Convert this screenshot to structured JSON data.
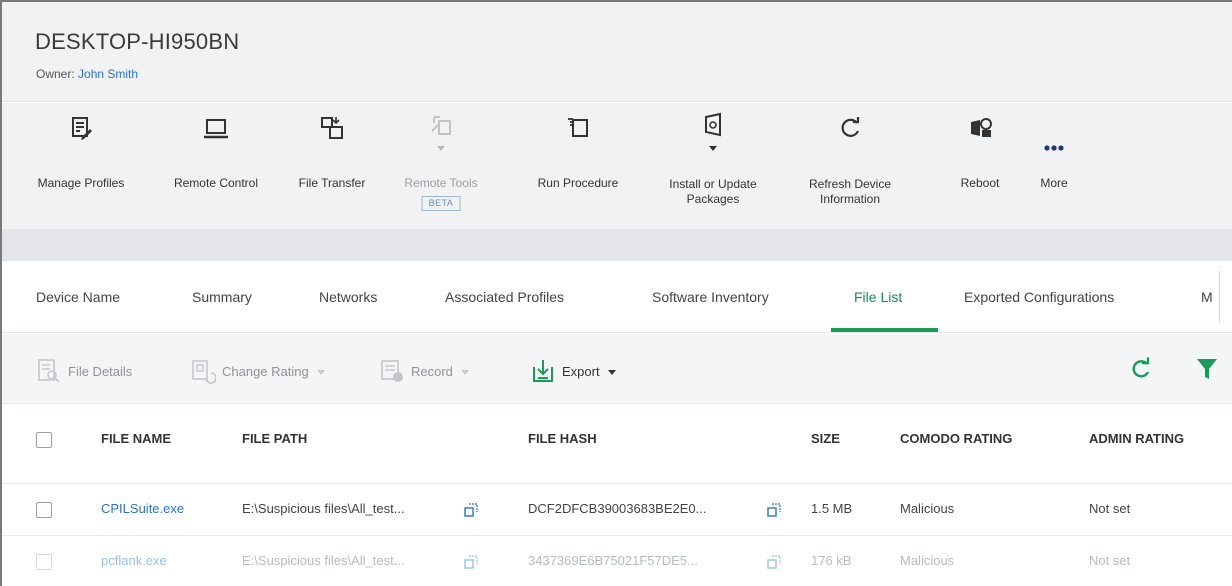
{
  "device": {
    "name": "DESKTOP-HI950BN",
    "owner_label": "Owner: ",
    "owner_name": "John Smith"
  },
  "toolbar": {
    "manage_profiles": "Manage Profiles",
    "remote_control": "Remote Control",
    "file_transfer": "File Transfer",
    "remote_tools": "Remote Tools",
    "remote_tools_badge": "BETA",
    "run_procedure": "Run Procedure",
    "install_update_line1": "Install or Update",
    "install_update_line2": "Packages",
    "refresh_line1": "Refresh Device",
    "refresh_line2": "Information",
    "reboot": "Reboot",
    "more": "More"
  },
  "tabs": {
    "device_name": "Device Name",
    "summary": "Summary",
    "networks": "Networks",
    "associated_profiles": "Associated Profiles",
    "software_inventory": "Software Inventory",
    "file_list": "File List",
    "exported_configurations": "Exported Configurations",
    "truncated": "M"
  },
  "actions": {
    "file_details": "File Details",
    "change_rating": "Change Rating",
    "record": "Record",
    "export": "Export"
  },
  "table": {
    "headers": {
      "file_name": "FILE NAME",
      "file_path": "FILE PATH",
      "file_hash": "FILE HASH",
      "size": "SIZE",
      "comodo_rating": "COMODO RATING",
      "admin_rating": "ADMIN RATING"
    },
    "rows": [
      {
        "file_name": "CPILSuite.exe",
        "file_path": "E:\\Suspicious files\\All_test...",
        "file_hash": "DCF2DFCB39003683BE2E0...",
        "size": "1.5 MB",
        "comodo_rating": "Malicious",
        "admin_rating": "Not set"
      },
      {
        "file_name": "pcflank.exe",
        "file_path": "E:\\Suspicious files\\All_test...",
        "file_hash": "3437369E6B75021F57DE5...",
        "size": "176 kB",
        "comodo_rating": "Malicious",
        "admin_rating": "Not set"
      }
    ]
  },
  "colors": {
    "accent_green": "#1a9b5a",
    "link_blue": "#2a73c8",
    "header_bg": "#f1f2f4"
  }
}
